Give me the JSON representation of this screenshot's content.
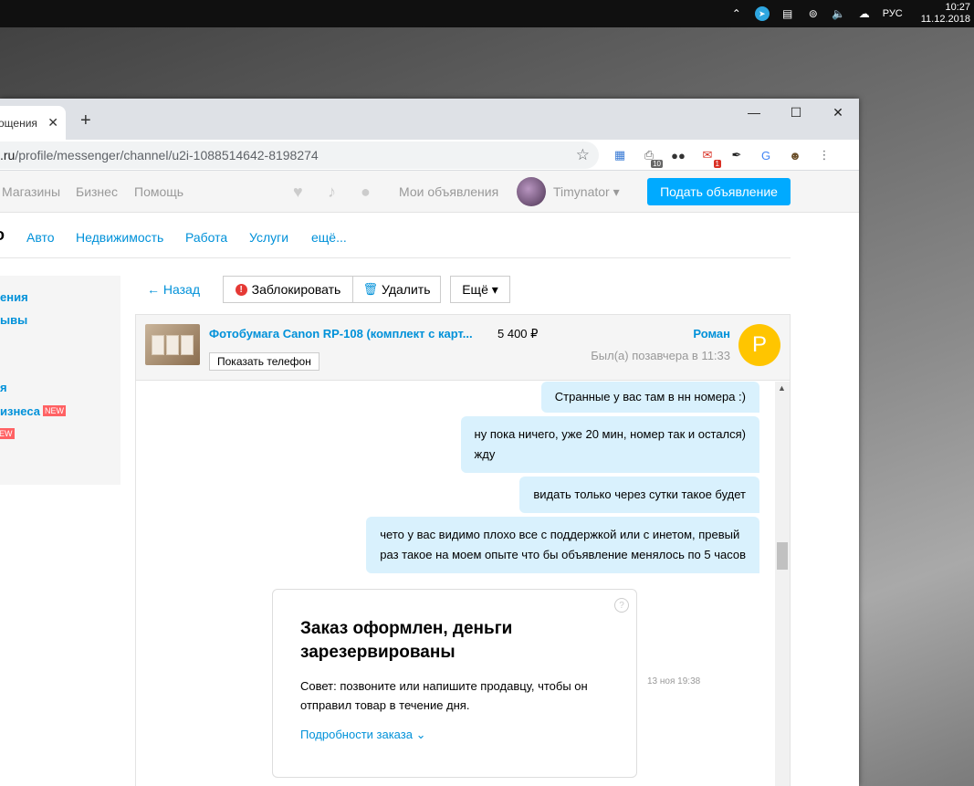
{
  "taskbar": {
    "lang": "РУС",
    "time": "10:27",
    "date": "11.12.2018",
    "icons": [
      "chevron-up-icon",
      "telegram-icon",
      "file-icon",
      "steam-icon",
      "volume-icon",
      "network-icon"
    ]
  },
  "browser": {
    "tab": {
      "title": "ощения",
      "close": "✕"
    },
    "new_tab": "+",
    "window_controls": {
      "minimize": "—",
      "maximize": "☐",
      "close": "✕"
    },
    "url": {
      "host": ".ru",
      "path": "/profile/messenger/channel/u2i-1088514642-8198274"
    },
    "extensions": [
      {
        "name": "calendar-icon",
        "glyph": "▦",
        "color": "#3a7bd5",
        "badge": ""
      },
      {
        "name": "printer-icon",
        "glyph": "⎙",
        "color": "#666666",
        "badge": "10"
      },
      {
        "name": "dots-icon",
        "glyph": "●●",
        "color": "#333333",
        "badge": ""
      },
      {
        "name": "mail-icon",
        "glyph": "✉",
        "color": "#d93025",
        "badge": "1"
      },
      {
        "name": "pen-icon",
        "glyph": "✒",
        "color": "#222222",
        "badge": ""
      },
      {
        "name": "translate-icon",
        "glyph": "G",
        "color": "#4285f4",
        "badge": ""
      },
      {
        "name": "profile-icon",
        "glyph": "☻",
        "color": "#6b4f2a",
        "badge": ""
      },
      {
        "name": "menu-dots-icon",
        "glyph": "⋮",
        "color": "#5f6368",
        "badge": ""
      }
    ]
  },
  "site": {
    "nav": [
      "Магазины",
      "Бизнес",
      "Помощь"
    ],
    "my_ads": "Мои объявления",
    "username": "Timynator ▾",
    "post_button": "Подать объявление",
    "logo_fragment": "o",
    "categories": [
      "Авто",
      "Недвижимость",
      "Работа",
      "Услуги",
      "ещё..."
    ]
  },
  "sidebar": {
    "items": [
      {
        "label": "ения",
        "badge": ""
      },
      {
        "label": "ывы",
        "badge": ""
      },
      {
        "label": "я",
        "badge": ""
      },
      {
        "label": "изнеса",
        "badge": "NEW"
      },
      {
        "label": "",
        "badge": "EW"
      }
    ]
  },
  "chat": {
    "back": "← Назад",
    "block": "Заблокировать",
    "delete": "Удалить",
    "more": "Ещё ▾",
    "item_title": "Фотобумага Canon RP-108 (комплект с карт...",
    "price": "5 400 ₽",
    "show_phone": "Показать телефон",
    "seller_name": "Роман",
    "seller_status": "Был(а) позавчера в 11:33",
    "seller_initial": "Р",
    "messages": [
      "Странные у вас там в нн номера :)",
      "ну пока ничего, уже 20 мин, номер так и остался)\nжду",
      "видать только через сутки такое будет",
      "чето у вас видимо плохо все с поддержкой или с инетом, превый\nраз такое на моем опыте что бы объявление менялось по 5 часов"
    ],
    "order": {
      "title": "Заказ оформлен, деньги зарезервированы",
      "text": "Совет: позвоните или напишите продавцу, чтобы он отправил товар в течение дня.",
      "link": "Подробности заказа",
      "help": "?",
      "time": "13 ноя 19:38"
    }
  }
}
